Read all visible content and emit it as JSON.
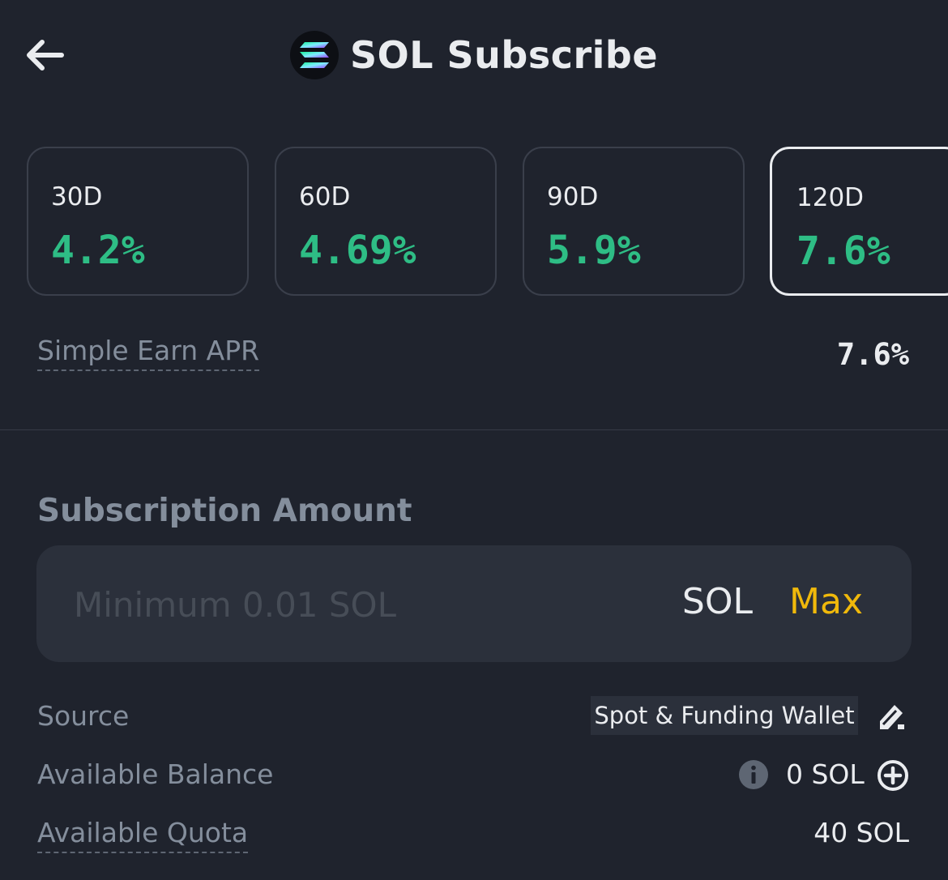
{
  "header": {
    "title": "SOL Subscribe",
    "back_icon": "arrow-left-icon",
    "coin_icon": "solana-logo-icon"
  },
  "terms": [
    {
      "days": "30D",
      "rate": "4.2%",
      "selected": false
    },
    {
      "days": "60D",
      "rate": "4.69%",
      "selected": false
    },
    {
      "days": "90D",
      "rate": "5.9%",
      "selected": false
    },
    {
      "days": "120D",
      "rate": "7.6%",
      "selected": true
    }
  ],
  "apr": {
    "label": "Simple Earn APR",
    "value": "7.6%"
  },
  "subscription": {
    "title": "Subscription Amount",
    "placeholder": "Minimum 0.01 SOL",
    "value": "",
    "unit": "SOL",
    "max_label": "Max"
  },
  "source": {
    "label": "Source",
    "value": "Spot & Funding Wallet",
    "edit_icon": "edit-icon"
  },
  "balance": {
    "label": "Available Balance",
    "value": "0 SOL",
    "info_icon": "info-icon",
    "add_icon": "plus-circle-icon"
  },
  "quota": {
    "label": "Available Quota",
    "value": "40 SOL"
  },
  "colors": {
    "background": "#1f232d",
    "positive": "#2ebd85",
    "accent": "#f0b90b",
    "panel": "#2b303b"
  }
}
